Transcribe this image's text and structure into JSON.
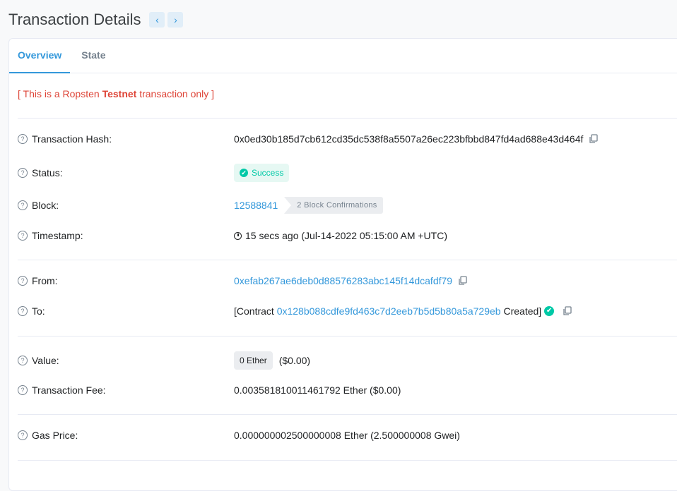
{
  "header": {
    "title": "Transaction Details",
    "prev_icon": "chevron-left-icon",
    "next_icon": "chevron-right-icon",
    "prev_glyph": "‹",
    "next_glyph": "›"
  },
  "tabs": [
    {
      "label": "Overview",
      "active": true
    },
    {
      "label": "State",
      "active": false
    }
  ],
  "notice": {
    "prefix": "[ This is a Ropsten ",
    "bold": "Testnet",
    "suffix": " transaction only ]"
  },
  "help_glyph": "?",
  "fields": {
    "tx_hash": {
      "label": "Transaction Hash:",
      "value": "0x0ed30b185d7cb612cd35dc538f8a5507a26ec223bfbbd847fd4ad688e43d464f"
    },
    "status": {
      "label": "Status:",
      "value": "Success",
      "glyph": "✔"
    },
    "block": {
      "label": "Block:",
      "value": "12588841",
      "confirmations": "2 Block Confirmations"
    },
    "timestamp": {
      "label": "Timestamp:",
      "value": "15 secs ago (Jul-14-2022 05:15:00 AM +UTC)"
    },
    "from": {
      "label": "From:",
      "value": "0xefab267ae6deb0d88576283abc145f14dcafdf79"
    },
    "to": {
      "label": "To:",
      "prefix": "[Contract ",
      "address": "0x128b088cdfe9fd463c7d2eeb7b5d5b80a5a729eb",
      "suffix": " Created]",
      "glyph": "✔"
    },
    "value": {
      "label": "Value:",
      "badge": "0 Ether",
      "usd": "($0.00)"
    },
    "fee": {
      "label": "Transaction Fee:",
      "value": "0.003581810011461792 Ether ($0.00)"
    },
    "gas_price": {
      "label": "Gas Price:",
      "value": "0.000000002500000008 Ether (2.500000008 Gwei)"
    }
  },
  "colors": {
    "accent": "#3498db",
    "success": "#00c9a7",
    "notice": "#de4437"
  }
}
